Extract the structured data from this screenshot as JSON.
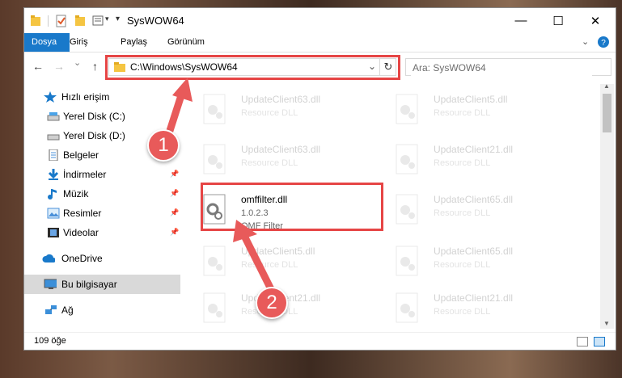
{
  "window": {
    "title": "SysWOW64",
    "controls": {
      "minimize": "—",
      "maximize": "☐",
      "close": "✕"
    }
  },
  "ribbon": {
    "tabs": [
      {
        "label": "Dosya",
        "active": true
      },
      {
        "label": "Giriş",
        "active": false
      },
      {
        "label": "Paylaş",
        "active": false
      },
      {
        "label": "Görünüm",
        "active": false
      }
    ],
    "expand_icon": "chevron-down-icon",
    "help_icon": "help-icon"
  },
  "navigation": {
    "back": "←",
    "forward": "→",
    "recent": "⌄",
    "up": "↑",
    "address": "C:\\Windows\\SysWOW64",
    "refresh": "↻",
    "search_placeholder": "Ara: SysWOW64"
  },
  "sidebar": {
    "items": [
      {
        "label": "Hızlı erişim",
        "icon": "star-icon",
        "pinned": false
      },
      {
        "label": "Yerel Disk (C:)",
        "icon": "drive-icon",
        "pinned": false
      },
      {
        "label": "Yerel Disk (D:)",
        "icon": "drive-icon",
        "pinned": false
      },
      {
        "label": "Belgeler",
        "icon": "document-icon",
        "pinned": false
      },
      {
        "label": "İndirmeler",
        "icon": "download-icon",
        "pinned": true
      },
      {
        "label": "Müzik",
        "icon": "music-icon",
        "pinned": true
      },
      {
        "label": "Resimler",
        "icon": "picture-icon",
        "pinned": true
      },
      {
        "label": "Videolar",
        "icon": "video-icon",
        "pinned": true
      },
      {
        "label": "OneDrive",
        "icon": "cloud-icon",
        "pinned": false
      },
      {
        "label": "Bu bilgisayar",
        "icon": "computer-icon",
        "pinned": false
      },
      {
        "label": "Ağ",
        "icon": "network-icon",
        "pinned": false
      }
    ]
  },
  "files": {
    "left_column": [
      {
        "name": "UpdateClient63.dll",
        "desc": "Resource DLL"
      },
      {
        "name": "UpdateClient63.dll",
        "desc": "Resource DLL"
      },
      {
        "name": "omffilter.dll",
        "version": "1.0.2.3",
        "desc": "OMF Filter"
      },
      {
        "name": "UpdateClient5.dll",
        "desc": "Resource DLL"
      },
      {
        "name": "UpdateClient21.dll",
        "desc": "Resource DLL"
      }
    ],
    "right_column": [
      {
        "name": "UpdateClient5.dll",
        "desc": "Resource DLL"
      },
      {
        "name": "UpdateClient21.dll",
        "desc": "Resource DLL"
      },
      {
        "name": "UpdateClient65.dll",
        "desc": "Resource DLL"
      },
      {
        "name": "UpdateClient65.dll",
        "desc": "Resource DLL"
      },
      {
        "name": "UpdateClient21.dll",
        "desc": "Resource DLL"
      }
    ]
  },
  "status": {
    "count": "109 öğe"
  },
  "annotations": {
    "badge_1": "1",
    "badge_2": "2",
    "colors": {
      "red": "#e64545",
      "accent": "#1979ca"
    }
  }
}
